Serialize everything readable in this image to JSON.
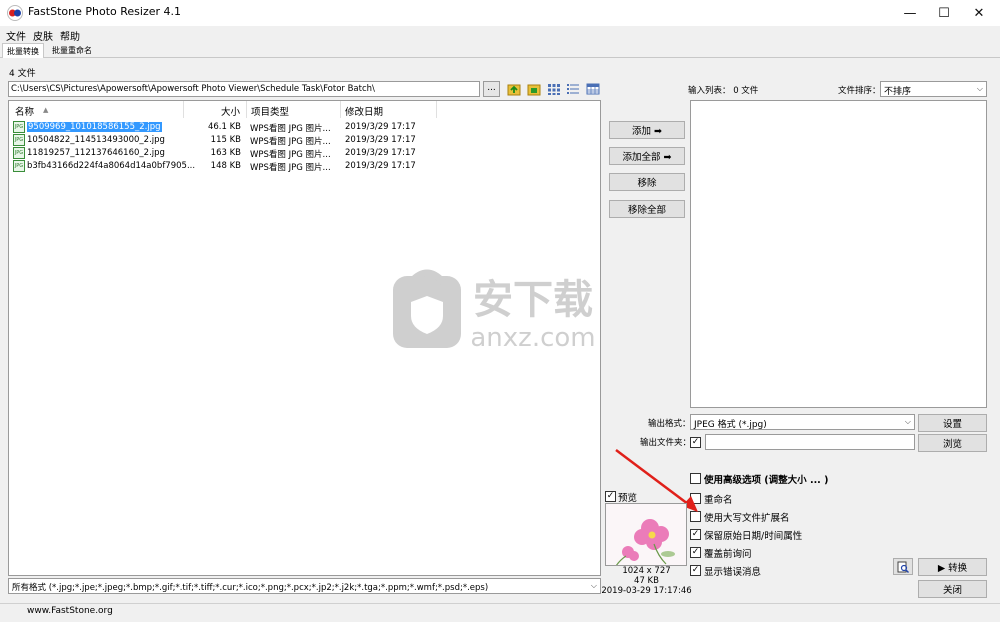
{
  "window": {
    "title": "FastStone Photo Resizer 4.1",
    "minimize_glyph": "—",
    "maximize_glyph": "☐",
    "close_glyph": "✕"
  },
  "menu": [
    "文件",
    "皮肤",
    "帮助"
  ],
  "tabs": [
    "批量转换",
    "批量重命名"
  ],
  "file_count": "4 文件",
  "path": "C:\\Users\\CS\\Pictures\\Apowersoft\\Apowersoft Photo Viewer\\Schedule Task\\Fotor Batch\\",
  "browse_dots": "...",
  "columns": {
    "name": "名称",
    "size": "大小",
    "type": "项目类型",
    "date": "修改日期"
  },
  "files": [
    {
      "name": "9509969_101018586155_2.jpg",
      "size": "46.1 KB",
      "type": "WPS看图 JPG 图片...",
      "date": "2019/3/29 17:17",
      "selected": true
    },
    {
      "name": "10504822_114513493000_2.jpg",
      "size": "115 KB",
      "type": "WPS看图 JPG 图片...",
      "date": "2019/3/29 17:17",
      "selected": false
    },
    {
      "name": "11819257_112137646160_2.jpg",
      "size": "163 KB",
      "type": "WPS看图 JPG 图片...",
      "date": "2019/3/29 17:17",
      "selected": false
    },
    {
      "name": "b3fb43166d224f4a8064d14a0bf7905...",
      "size": "148 KB",
      "type": "WPS看图 JPG 图片...",
      "date": "2019/3/29 17:17",
      "selected": false
    }
  ],
  "file_icon_text": "JPG",
  "filter": "所有格式 (*.jpg;*.jpe;*.jpeg;*.bmp;*.gif;*.tif;*.tiff;*.cur;*.ico;*.png;*.pcx;*.jp2;*.j2k;*.tga;*.ppm;*.wmf;*.psd;*.eps)",
  "buttons": {
    "add": "添加 ➡",
    "add_all": "添加全部 ➡",
    "remove": "移除",
    "remove_all": "移除全部",
    "settings": "设置",
    "browse": "浏览",
    "convert": "▶ 转换",
    "close": "关闭"
  },
  "input_list_label": "输入列表： 0 文件",
  "sort_label": "文件排序：",
  "sort_value": "不排序",
  "output_format_label": "输出格式：",
  "output_format_value": "JPEG 格式 (*.jpg)",
  "output_folder_label": "输出文件夹：",
  "output_folder_value": "",
  "options": [
    {
      "label": "使用高级选项 (调整大小 ... )",
      "checked": false,
      "bold": true
    },
    {
      "label": "重命名",
      "checked": false,
      "bold": false
    },
    {
      "label": "使用大写文件扩展名",
      "checked": false,
      "bold": false
    },
    {
      "label": "保留原始日期/时间属性",
      "checked": true,
      "bold": false
    },
    {
      "label": "覆盖前询问",
      "checked": true,
      "bold": false
    },
    {
      "label": "显示错误消息",
      "checked": true,
      "bold": false
    }
  ],
  "preview": {
    "label": "预览",
    "dimensions": "1024 x 727",
    "size": "47 KB",
    "date": "2019-03-29 17:17:46"
  },
  "watermark": {
    "cn": "安下载",
    "en": "anxz.com"
  },
  "status": "www.FastStone.org",
  "colors": {
    "selection": "#3399ff",
    "accent_green": "#1a9a1a",
    "arrow_red": "#e0201a"
  }
}
